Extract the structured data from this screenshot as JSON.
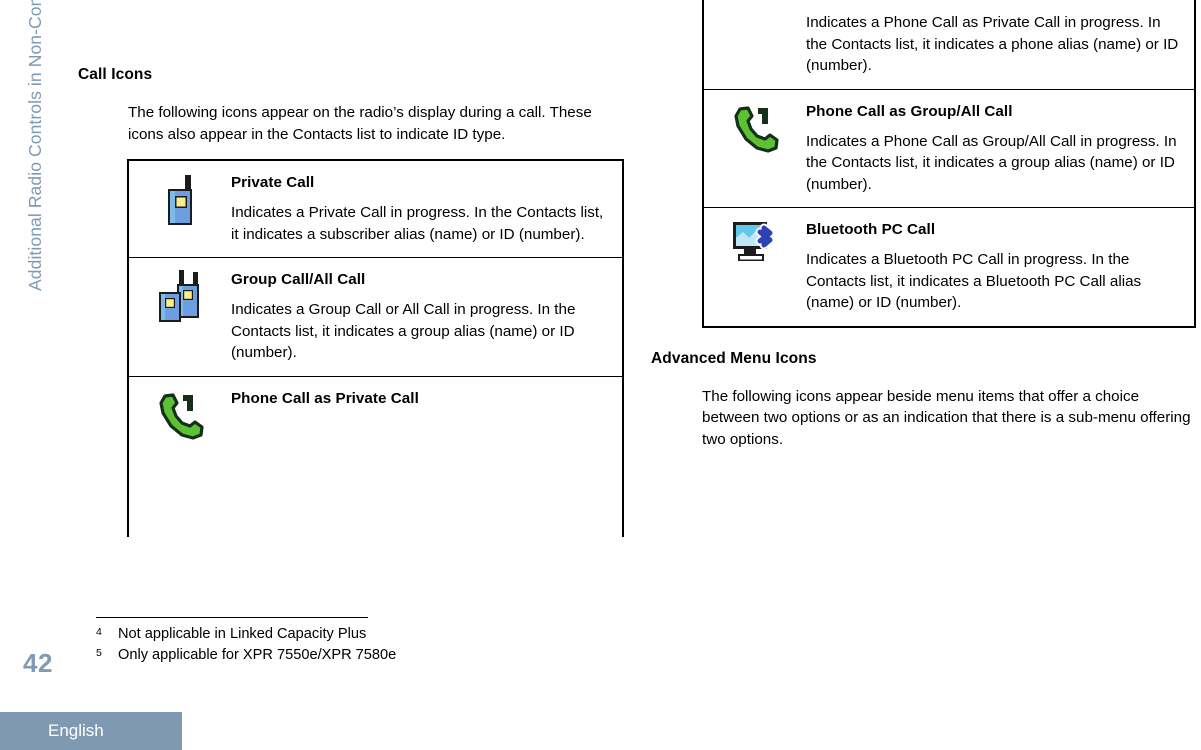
{
  "sidebar": {
    "chapter_label": "Additional Radio Controls in Non-Connect Plus Mode"
  },
  "page": {
    "number": "42",
    "language_tab": "English"
  },
  "left_column": {
    "heading": "Call Icons",
    "intro": "The following icons appear on the radio’s display during a call. These icons also appear in the Contacts list to indicate ID type.",
    "entries": [
      {
        "icon": "private-call-radio-icon",
        "title": "Private Call",
        "description": "Indicates a Private Call in progress. In the Contacts list, it indicates a subscriber alias (name) or ID (number)."
      },
      {
        "icon": "group-call-two-radios-icon",
        "title": "Group Call/All Call",
        "description": "Indicates a Group Call or All Call in progress. In the Contacts list, it indicates a group alias (name) or ID (number)."
      },
      {
        "icon": "phone-handset-icon",
        "title": "Phone Call as Private Call",
        "description": ""
      }
    ]
  },
  "right_column": {
    "continued_entry": {
      "description": "Indicates a Phone Call as Private Call in progress. In the Contacts list, it indicates a phone alias (name) or ID (number)."
    },
    "entries": [
      {
        "icon": "phone-handset-icon",
        "title": "Phone Call as Group/All Call",
        "description": "Indicates a Phone Call as Group/All Call in progress. In the Contacts list, it indicates a group alias (name) or ID (number)."
      },
      {
        "icon": "bluetooth-pc-monitor-icon",
        "title": "Bluetooth PC Call",
        "description": "Indicates a Bluetooth PC Call in progress. In the Contacts list, it indicates a Bluetooth PC Call alias (name) or ID (number)."
      }
    ],
    "heading": "Advanced Menu Icons",
    "intro": "The following icons appear beside menu items that offer a choice between two options or as an indication that there is a sub-menu offering two options."
  },
  "footnotes": [
    {
      "mark": "4",
      "text": "Not applicable in Linked Capacity Plus"
    },
    {
      "mark": "5",
      "text": "Only applicable for XPR 7550e/XPR 7580e"
    }
  ],
  "colors": {
    "accent_blue_gray": "#7e9ab5",
    "tab_background": "#8099b2",
    "radio_body_blue": "#6f9ee0",
    "radio_screen_yellow": "#fbef8c",
    "phone_green": "#5cc234",
    "bluetooth_blue": "#2d43b5"
  }
}
